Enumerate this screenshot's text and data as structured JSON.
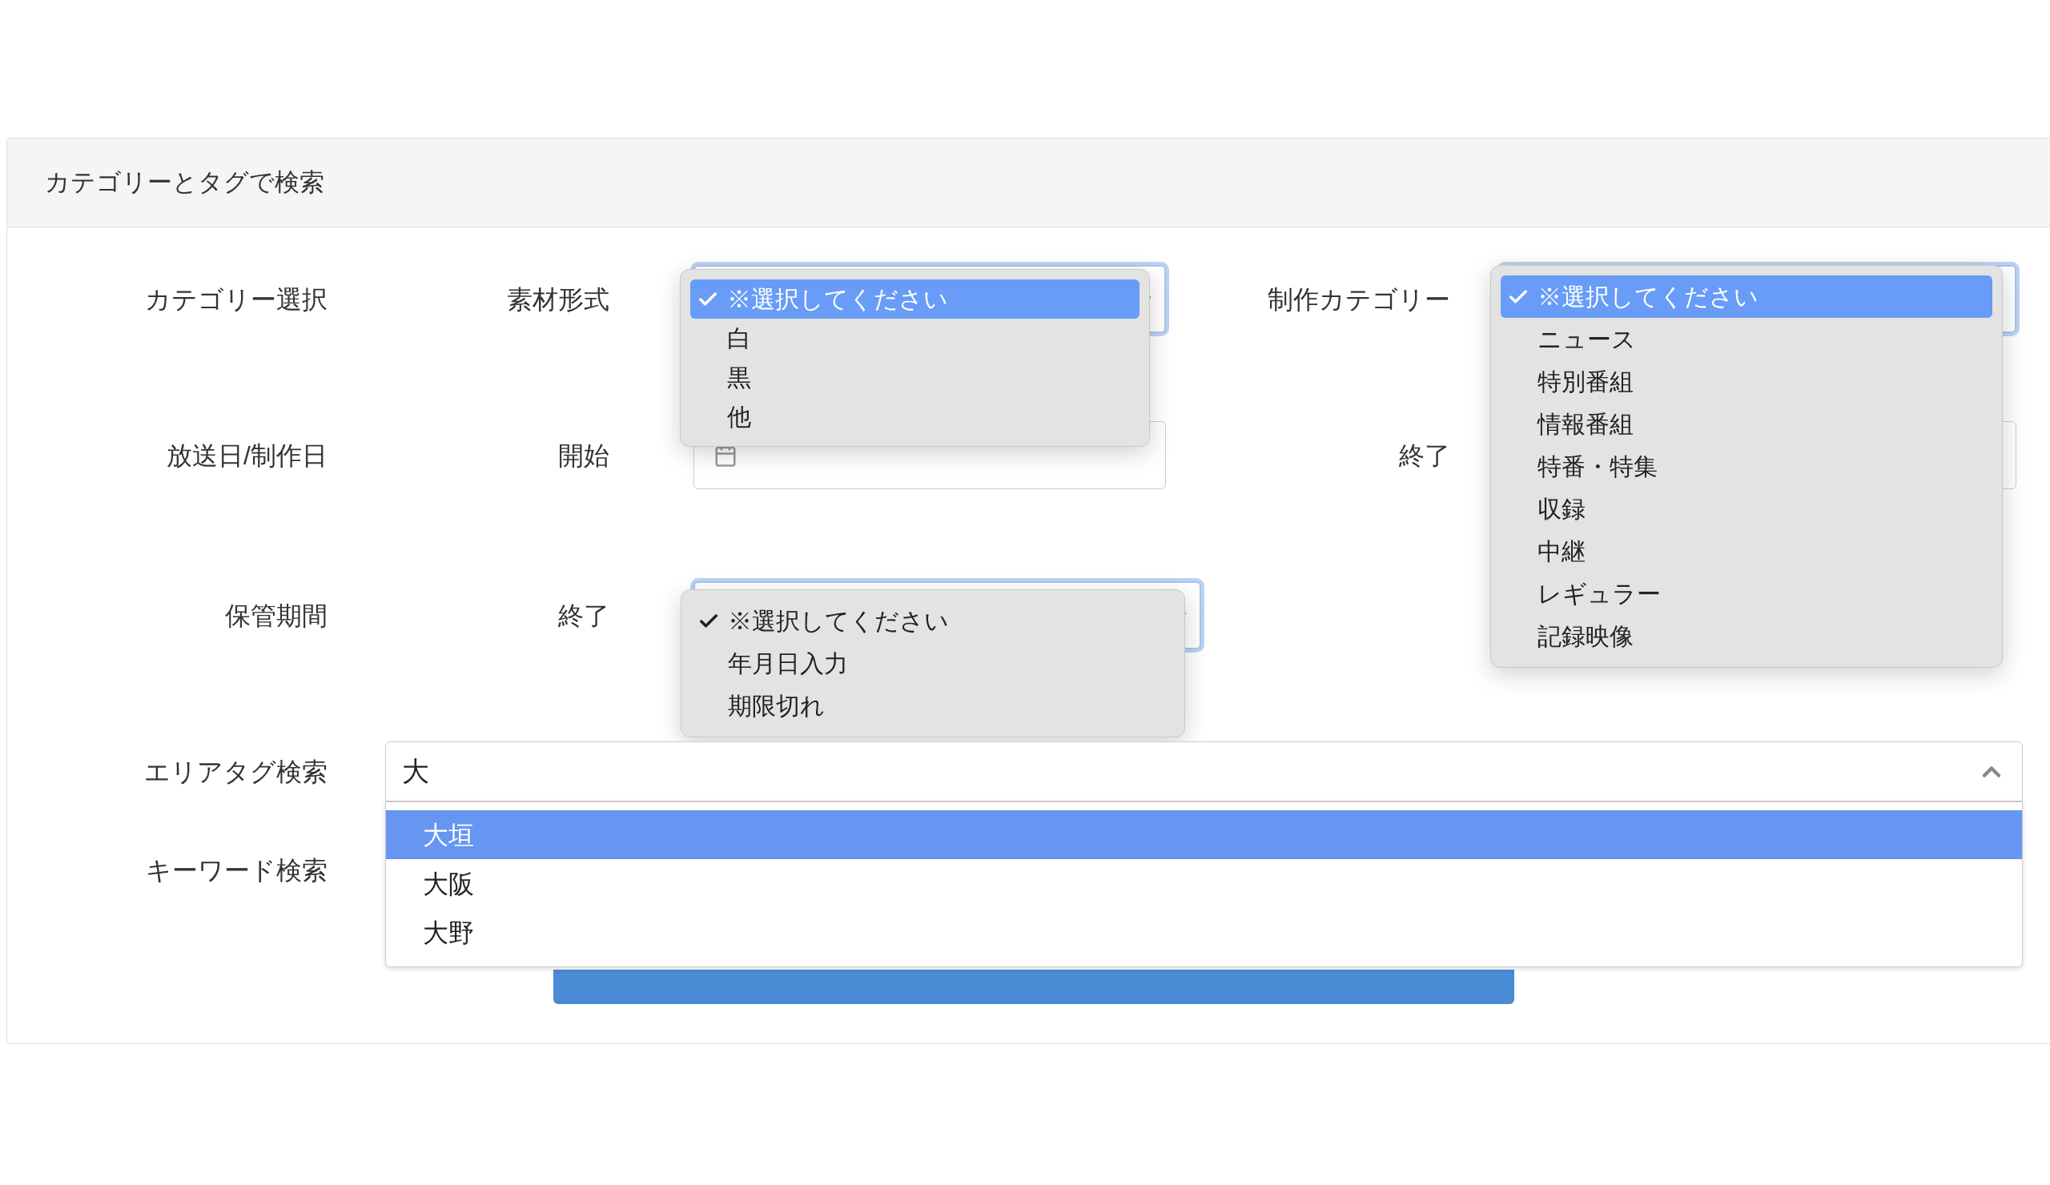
{
  "panel": {
    "title": "カテゴリーとタグで検索"
  },
  "rows": [
    {
      "label": "カテゴリー選択",
      "fields": [
        {
          "kind": "select",
          "label": "素材形式",
          "options": [
            {
              "text": "※選択してください",
              "checked": true,
              "selected": true
            },
            {
              "text": "白",
              "checked": false,
              "selected": false
            },
            {
              "text": "黒",
              "checked": false,
              "selected": false
            },
            {
              "text": "他",
              "checked": false,
              "selected": false
            }
          ]
        },
        {
          "kind": "select",
          "label": "制作カテゴリー",
          "options": [
            {
              "text": "※選択してください",
              "checked": true,
              "selected": true
            },
            {
              "text": "ニュース",
              "checked": false,
              "selected": false
            },
            {
              "text": "特別番組",
              "checked": false,
              "selected": false
            },
            {
              "text": "情報番組",
              "checked": false,
              "selected": false
            },
            {
              "text": "特番・特集",
              "checked": false,
              "selected": false
            },
            {
              "text": "収録",
              "checked": false,
              "selected": false
            },
            {
              "text": "中継",
              "checked": false,
              "selected": false
            },
            {
              "text": "レギュラー",
              "checked": false,
              "selected": false
            },
            {
              "text": "記録映像",
              "checked": false,
              "selected": false
            }
          ]
        }
      ]
    },
    {
      "label": "放送日/制作日",
      "fields": [
        {
          "kind": "date",
          "label": "開始"
        },
        {
          "kind": "date",
          "label": "終了"
        }
      ]
    },
    {
      "label": "保管期間",
      "fields": [
        {
          "kind": "select",
          "label": "終了",
          "options": [
            {
              "text": "※選択してください",
              "checked": true,
              "selected": false
            },
            {
              "text": "年月日入力",
              "checked": false,
              "selected": false
            },
            {
              "text": "期限切れ",
              "checked": false,
              "selected": false
            }
          ]
        }
      ]
    }
  ],
  "area_tag": {
    "label": "エリアタグ検索",
    "value": "大",
    "options": [
      {
        "text": "大垣",
        "selected": true
      },
      {
        "text": "大阪",
        "selected": false
      },
      {
        "text": "大野",
        "selected": false
      }
    ]
  },
  "keyword": {
    "label": "キーワード検索"
  }
}
